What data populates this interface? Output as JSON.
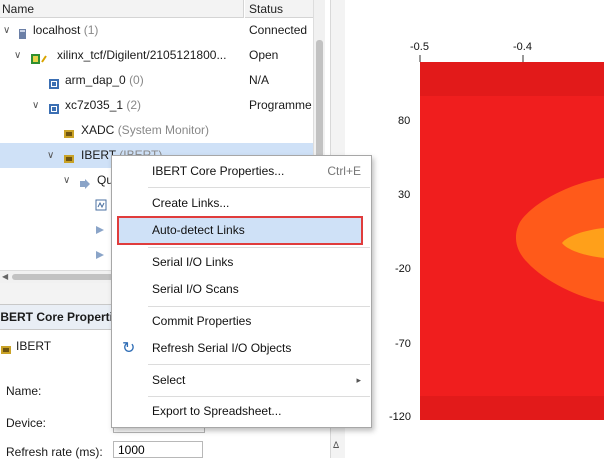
{
  "tree": {
    "columns": {
      "name": "Name",
      "status": "Status"
    },
    "rows": [
      {
        "label": "localhost",
        "count": "(1)",
        "status": "Connected"
      },
      {
        "label": "xilinx_tcf/Digilent/2105121800...",
        "status": "Open"
      },
      {
        "label": "arm_dap_0",
        "count": "(0)",
        "status": "N/A"
      },
      {
        "label": "xc7z035_1",
        "count": "(2)",
        "status": "Programme"
      },
      {
        "label": "XADC",
        "count": "(System Monitor)",
        "status": ""
      },
      {
        "label": "IBERT",
        "count": "(IBERT)",
        "status": ""
      },
      {
        "label": "Qu",
        "status": ""
      }
    ]
  },
  "properties": {
    "title": "IBERT Core Properties",
    "object": "IBERT",
    "name_label": "Name:",
    "device_label": "Device:",
    "refresh_label": "Refresh rate (ms):",
    "refresh_value": "1000"
  },
  "context_menu": {
    "items": [
      {
        "label": "IBERT Core Properties...",
        "shortcut": "Ctrl+E"
      },
      {
        "label": "Create Links..."
      },
      {
        "label": "Auto-detect Links"
      },
      {
        "label": "Serial I/O Links"
      },
      {
        "label": "Serial I/O Scans"
      },
      {
        "label": "Commit Properties"
      },
      {
        "label": "Refresh Serial I/O Objects"
      },
      {
        "label": "Select",
        "submenu": "▸"
      },
      {
        "label": "Export to Spreadsheet..."
      }
    ]
  },
  "chart_data": {
    "type": "heatmap",
    "x_ticks": [
      "-0.5",
      "-0.4"
    ],
    "y_ticks": [
      "80",
      "30",
      "-20",
      "-70",
      "-120"
    ],
    "colors": {
      "outer": "#f01e1e",
      "band": "#ff5a1a",
      "inner": "#ffa01a"
    }
  },
  "colors": {
    "selection": "#cfe1f7",
    "highlight_border": "#e03c3c"
  }
}
